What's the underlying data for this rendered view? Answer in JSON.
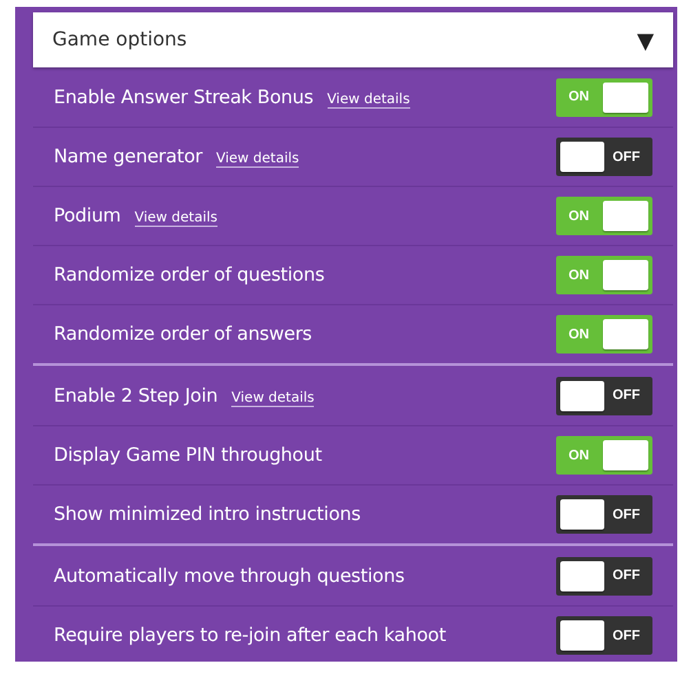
{
  "header": {
    "title": "Game options",
    "caret": "▼"
  },
  "groups": [
    {
      "options": [
        {
          "label": "Enable Answer Streak Bonus",
          "link": "View details",
          "on": true,
          "state_text": "ON"
        },
        {
          "label": "Name generator",
          "link": "View details",
          "on": false,
          "state_text": "OFF"
        },
        {
          "label": "Podium",
          "link": "View details",
          "on": true,
          "state_text": "ON"
        },
        {
          "label": "Randomize order of questions",
          "on": true,
          "state_text": "ON"
        },
        {
          "label": "Randomize order of answers",
          "on": true,
          "state_text": "ON"
        }
      ]
    },
    {
      "options": [
        {
          "label": "Enable 2 Step Join",
          "link": "View details",
          "on": false,
          "state_text": "OFF"
        },
        {
          "label": "Display Game PIN throughout",
          "on": true,
          "state_text": "ON"
        },
        {
          "label": "Show minimized intro instructions",
          "on": false,
          "state_text": "OFF"
        }
      ]
    },
    {
      "options": [
        {
          "label": "Automatically move through questions",
          "on": false,
          "state_text": "OFF"
        },
        {
          "label": "Require players to re-join after each kahoot",
          "on": false,
          "state_text": "OFF"
        }
      ]
    }
  ]
}
